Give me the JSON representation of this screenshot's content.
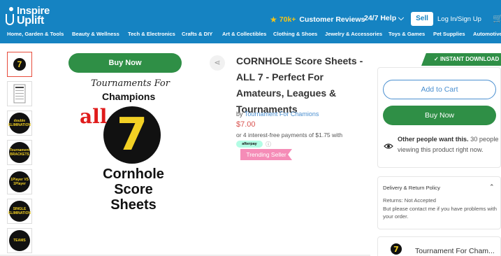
{
  "header": {
    "logo_line1": "Inspire",
    "logo_line2": "Uplift",
    "reviews_count": "70k+",
    "reviews_label": "Customer Reviews",
    "help": "24/7 Help ⌵",
    "sell": "Sell",
    "login": "Log In/Sign Up"
  },
  "nav": {
    "items": [
      "Home, Garden & Tools",
      "Beauty & Wellness",
      "Tech & Electronics",
      "Crafts & DIY",
      "Art & Collectibles",
      "Clothing & Shoes",
      "Jewelry & Accessories",
      "Toys & Games",
      "Pet Supplies",
      "Automotive"
    ]
  },
  "thumbnails": {
    "labels": [
      "",
      "",
      "double ELIMINATION",
      "Tournament BRACKETS",
      "1Player VS 1Player",
      "SINGLE ELIMINATION",
      "TEAMS"
    ]
  },
  "image": {
    "buy_now": "Buy Now",
    "line1": "Tournaments For",
    "line2": "Champions",
    "all": "all",
    "seven": "7",
    "cornhole": "Cornhole",
    "score": "Score",
    "sheets": "Sheets"
  },
  "product": {
    "title": "CORNHOLE Score Sheets - ALL 7 - Perfect For Amateurs, Leagues & Tournaments",
    "by": "by",
    "seller": "Tournament For Chamions",
    "price": "$7.00",
    "installments": "or 4 interest-free payments of $1.75 with",
    "afterpay": "afterpay",
    "trending": "Trending Seller"
  },
  "panel": {
    "instant_download": "INSTANT DOWNLOAD",
    "add_to_cart": "Add to Cart",
    "buy_now": "Buy Now",
    "others_bold": "Other people want this.",
    "others_rest": " 30 people viewing this product right now."
  },
  "policy": {
    "title": "Delivery & Return Policy",
    "returns": "Returns: Not Accepted",
    "contact": "But please contact me if you have problems with your order."
  },
  "seller_card": {
    "name": "Tournament For Cham..."
  },
  "colors": {
    "header_blue": "#1583c2",
    "green": "#2f8f46",
    "price_red": "#d9534f",
    "link_blue": "#4a8fd0",
    "trending_pink": "#f58cb7"
  }
}
